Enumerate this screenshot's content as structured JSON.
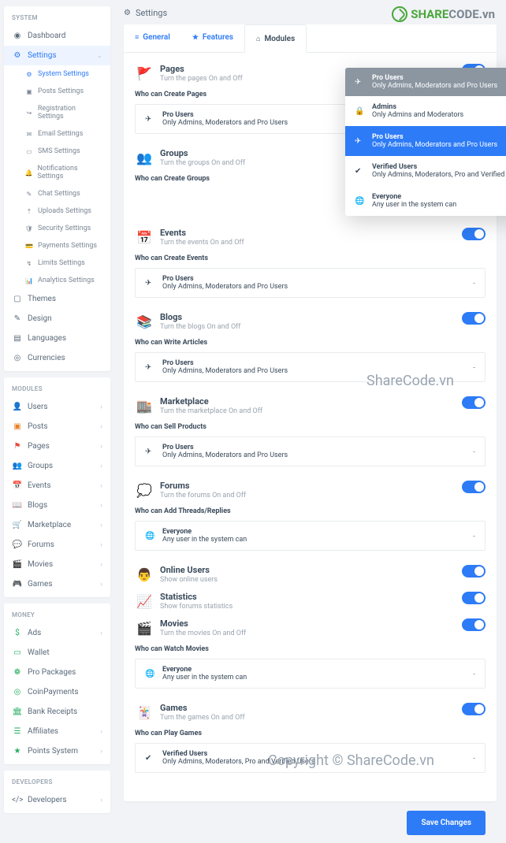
{
  "logo": {
    "brand1": "SHARE",
    "brand2": "CODE",
    "tld": ".vn"
  },
  "watermark1": "ShareCode.vn",
  "watermark2": "Copyright © ShareCode.vn",
  "page_title": "Settings",
  "tabs": [
    {
      "label": "General",
      "icon": "≡"
    },
    {
      "label": "Features",
      "icon": "★"
    },
    {
      "label": "Modules",
      "icon": "⌂"
    }
  ],
  "sidebar": {
    "groups": [
      {
        "header": "SYSTEM",
        "items": [
          {
            "icon": "◉",
            "label": "Dashboard"
          },
          {
            "icon": "⚙",
            "label": "Settings",
            "active": true,
            "expand": true,
            "sub": [
              {
                "icon": "⚙",
                "label": "System Settings",
                "active": true
              },
              {
                "icon": "▣",
                "label": "Posts Settings"
              },
              {
                "icon": "↪",
                "label": "Registration Settings"
              },
              {
                "icon": "✉",
                "label": "Email Settings"
              },
              {
                "icon": "▭",
                "label": "SMS Settings"
              },
              {
                "icon": "🔔",
                "label": "Notifications Settings"
              },
              {
                "icon": "✎",
                "label": "Chat Settings"
              },
              {
                "icon": "⇡",
                "label": "Uploads Settings"
              },
              {
                "icon": "🛡",
                "label": "Security Settings"
              },
              {
                "icon": "💳",
                "label": "Payments Settings"
              },
              {
                "icon": "↯",
                "label": "Limits Settings"
              },
              {
                "icon": "📊",
                "label": "Analytics Settings"
              }
            ]
          },
          {
            "icon": "▢",
            "label": "Themes"
          },
          {
            "icon": "✎",
            "label": "Design"
          },
          {
            "icon": "▤",
            "label": "Languages"
          },
          {
            "icon": "◎",
            "label": "Currencies"
          }
        ]
      },
      {
        "header": "MODULES",
        "items": [
          {
            "icon": "👤",
            "label": "Users",
            "chev": true,
            "color": "#e74c3c"
          },
          {
            "icon": "▣",
            "label": "Posts",
            "chev": true,
            "color": "#e67e22"
          },
          {
            "icon": "⚑",
            "label": "Pages",
            "chev": true,
            "color": "#e74c3c"
          },
          {
            "icon": "👥",
            "label": "Groups",
            "chev": true,
            "color": "#e74c3c"
          },
          {
            "icon": "📅",
            "label": "Events",
            "chev": true,
            "color": "#e74c3c"
          },
          {
            "icon": "📖",
            "label": "Blogs",
            "chev": true,
            "color": "#e74c3c"
          },
          {
            "icon": "🛒",
            "label": "Marketplace",
            "chev": true,
            "color": "#e74c3c"
          },
          {
            "icon": "💬",
            "label": "Forums",
            "chev": true,
            "color": "#e74c3c"
          },
          {
            "icon": "🎬",
            "label": "Movies",
            "chev": true,
            "color": "#e74c3c"
          },
          {
            "icon": "🎮",
            "label": "Games",
            "chev": true,
            "color": "#e74c3c"
          }
        ]
      },
      {
        "header": "MONEY",
        "items": [
          {
            "icon": "$",
            "label": "Ads",
            "chev": true,
            "color": "#27ae60"
          },
          {
            "icon": "▭",
            "label": "Wallet",
            "color": "#27ae60"
          },
          {
            "icon": "❁",
            "label": "Pro Packages",
            "color": "#27ae60"
          },
          {
            "icon": "◎",
            "label": "CoinPayments",
            "color": "#27ae60"
          },
          {
            "icon": "🏛",
            "label": "Bank Receipts",
            "color": "#27ae60"
          },
          {
            "icon": "☰",
            "label": "Affiliates",
            "chev": true,
            "color": "#27ae60"
          },
          {
            "icon": "★",
            "label": "Points System",
            "chev": true,
            "color": "#27ae60"
          }
        ]
      },
      {
        "header": "DEVELOPERS",
        "items": [
          {
            "icon": "</>",
            "label": "Developers",
            "chev": true
          }
        ]
      }
    ]
  },
  "modules": [
    {
      "icon": "🚩",
      "title": "Pages",
      "sub": "Turn the pages On and Off",
      "perm": "Who can Create Pages",
      "sel_icon": "✈",
      "sel_t": "Pro Users",
      "sel_s": "Only Admins, Moderators and Pro Users"
    },
    {
      "icon": "👥",
      "title": "Groups",
      "sub": "Turn the groups On and Off",
      "perm": "Who can Create Groups"
    },
    {
      "icon": "📅",
      "title": "Events",
      "sub": "Turn the events On and Off",
      "perm": "Who can Create Events",
      "sel_icon": "✈",
      "sel_t": "Pro Users",
      "sel_s": "Only Admins, Moderators and Pro Users"
    },
    {
      "icon": "📚",
      "title": "Blogs",
      "sub": "Turn the blogs On and Off",
      "perm": "Who can Write Articles",
      "sel_icon": "✈",
      "sel_t": "Pro Users",
      "sel_s": "Only Admins, Moderators and Pro Users"
    },
    {
      "icon": "🏬",
      "title": "Marketplace",
      "sub": "Turn the marketplace On and Off",
      "perm": "Who can Sell Products",
      "sel_icon": "✈",
      "sel_t": "Pro Users",
      "sel_s": "Only Admins, Moderators and Pro Users"
    },
    {
      "icon": "💭",
      "title": "Forums",
      "sub": "Turn the forums On and Off",
      "perm": "Who can Add Threads/Replies",
      "sel_icon": "🌐",
      "sel_t": "Everyone",
      "sel_s": "Any user in the system can"
    },
    {
      "icon": "👨",
      "title": "Online Users",
      "sub": "Show online users"
    },
    {
      "icon": "📈",
      "title": "Statistics",
      "sub": "Show forums statistics"
    },
    {
      "icon": "🎬",
      "title": "Movies",
      "sub": "Turn the movies On and Off",
      "perm": "Who can Watch Movies",
      "sel_icon": "🌐",
      "sel_t": "Everyone",
      "sel_s": "Any user in the system can"
    },
    {
      "icon": "🃏",
      "title": "Games",
      "sub": "Turn the games On and Off",
      "perm": "Who can Play Games",
      "sel_icon": "✔",
      "sel_t": "Verified Users",
      "sel_s": "Only Admins, Moderators, Pro and Verified Users"
    }
  ],
  "dropdown": {
    "head": {
      "icon": "✈",
      "t": "Pro Users",
      "s": "Only Admins, Moderators and Pro Users"
    },
    "opts": [
      {
        "icon": "🔒",
        "t": "Admins",
        "s": "Only Admins and Moderators"
      },
      {
        "icon": "✈",
        "t": "Pro Users",
        "s": "Only Admins, Moderators and Pro Users",
        "sel": true
      },
      {
        "icon": "✔",
        "t": "Verified Users",
        "s": "Only Admins, Moderators, Pro and Verified Users"
      },
      {
        "icon": "🌐",
        "t": "Everyone",
        "s": "Any user in the system can"
      }
    ]
  },
  "save_label": "Save Changes"
}
